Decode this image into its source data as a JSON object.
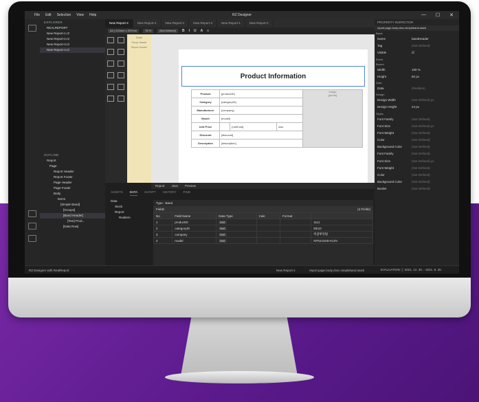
{
  "app": {
    "title": "RZ Designer",
    "menu": [
      "File",
      "Edit",
      "Selection",
      "View",
      "Help"
    ],
    "window_controls": [
      "—",
      "☐",
      "✕"
    ]
  },
  "explorer": {
    "header": "EXPLORER",
    "root": "REALREPORT",
    "files": [
      "New Report-1.r2",
      "New Report-2.r2",
      "New Report-3.r2",
      "New Report-4.r2"
    ]
  },
  "tabs": [
    "New Report-4",
    "New Report-4",
    "New Report-1",
    "New Report-4",
    "New Report-1",
    "New Report-2"
  ],
  "toolbar": {
    "page_size": "A4 | 210mm x 297mm",
    "zoom": "75 %",
    "font": "(Not Defined)",
    "tools": [
      "B",
      "I",
      "U",
      "A",
      "≡"
    ]
  },
  "bands": [
    "Detail",
    "Group Header",
    "Report Header"
  ],
  "report": {
    "title": "Product Information",
    "rows": [
      {
        "label": "Product",
        "value": "[productID]"
      },
      {
        "label": "Category",
        "value": "[categoryID]"
      },
      {
        "label": "Manufacturer",
        "value": "[company]"
      },
      {
        "label": "Model",
        "value": "[model]"
      },
      {
        "label": "Unit Price",
        "value": "",
        "extra": "[unitCost]",
        "extra2": "won"
      },
      {
        "label": "Discount",
        "value": "[discount]"
      },
      {
        "label": "Description",
        "value": "[description]"
      }
    ],
    "image_header": "Image",
    "image_value": "[photo]"
  },
  "canvas_tabs": [
    "Report",
    "Json",
    "Preview"
  ],
  "outline": {
    "header": "OUTLINE",
    "items": [
      "Report",
      "Page",
      "Report Header",
      "Report Footer",
      "Page Header",
      "Page Footer",
      "Body",
      "Items",
      "[Simple Band]",
      "[Groups]",
      "[Band Header]",
      "[Text] Prod...",
      "[Data Row]"
    ]
  },
  "bottom_panel": {
    "tabs": [
      "ASSETS",
      "DATA",
      "SCRIPT",
      "HISTORY",
      "FIND"
    ],
    "active_tab": "DATA",
    "data_tree": [
      "Data",
      "Stock",
      "Report",
      "Realtem"
    ],
    "type_label": "Type : Band",
    "fields_label": "Fields",
    "fields_count": "(4 Fields)",
    "columns": [
      "No",
      "Field Name",
      "Data Type",
      "Calc",
      "Format",
      ""
    ],
    "rows": [
      {
        "no": "1",
        "name": "productID",
        "type": "text",
        "calc": "",
        "format": "",
        "sample": "1111"
      },
      {
        "no": "2",
        "name": "categoryID",
        "type": "text",
        "calc": "",
        "format": "",
        "sample": "DE10"
      },
      {
        "no": "3",
        "name": "company",
        "type": "text",
        "calc": "",
        "format": "",
        "sample": "이글루유틸"
      },
      {
        "no": "4",
        "name": "model",
        "type": "text",
        "calc": "",
        "format": "",
        "sample": "NTN1010D-K10V"
      }
    ]
  },
  "properties": {
    "header": "PROPERTY INSPECTOR",
    "path": "report.page.body.cbsc.simpleband.stack",
    "sections": [
      {
        "name": "Basic",
        "rows": [
          {
            "k": "Name",
            "v": "bandHeader",
            "real": true
          },
          {
            "k": "Tag",
            "v": "(Not Defined)"
          },
          {
            "k": "Visible",
            "v": "☑",
            "real": true
          }
        ]
      },
      {
        "name": "Event",
        "rows": []
      },
      {
        "name": "Bound",
        "rows": [
          {
            "k": "Width",
            "v": "100  %",
            "real": true
          },
          {
            "k": "Height",
            "v": "82  px",
            "real": true
          }
        ]
      },
      {
        "name": "Data",
        "rows": [
          {
            "k": "Data",
            "v": "(Realtem)"
          }
        ]
      },
      {
        "name": "Design",
        "rows": [
          {
            "k": "Design Width",
            "v": "(Not Defined)  px"
          },
          {
            "k": "Design Height",
            "v": "24  px",
            "real": true
          }
        ]
      },
      {
        "name": "Styles",
        "rows": [
          {
            "k": "Font Family",
            "v": "(Not Defined)"
          },
          {
            "k": "Font Size",
            "v": "(Not Defined)  px"
          },
          {
            "k": "Font Weight",
            "v": "(Not Defined)"
          },
          {
            "k": "Color",
            "v": "(Not Defined)"
          },
          {
            "k": "Background Color",
            "v": "(Not Defined)"
          },
          {
            "k": "Font Family",
            "v": "(Not Defined)"
          },
          {
            "k": "Font Size",
            "v": "(Not Defined)  px"
          },
          {
            "k": "Font Weight",
            "v": "(Not Defined)"
          },
          {
            "k": "Color",
            "v": "(Not Defined)"
          },
          {
            "k": "Background Color",
            "v": "(Not Defined)"
          },
          {
            "k": "Border",
            "v": "(Not Defined)"
          }
        ]
      }
    ]
  },
  "status": {
    "left": "RZ Designer with RealReport",
    "file": "New Report-1",
    "path": "report.page.body.cbsc.simpleband.stack",
    "license": "EVALUATION  ⓘ 2021. 12. 30. - 2021. 8. 25."
  }
}
